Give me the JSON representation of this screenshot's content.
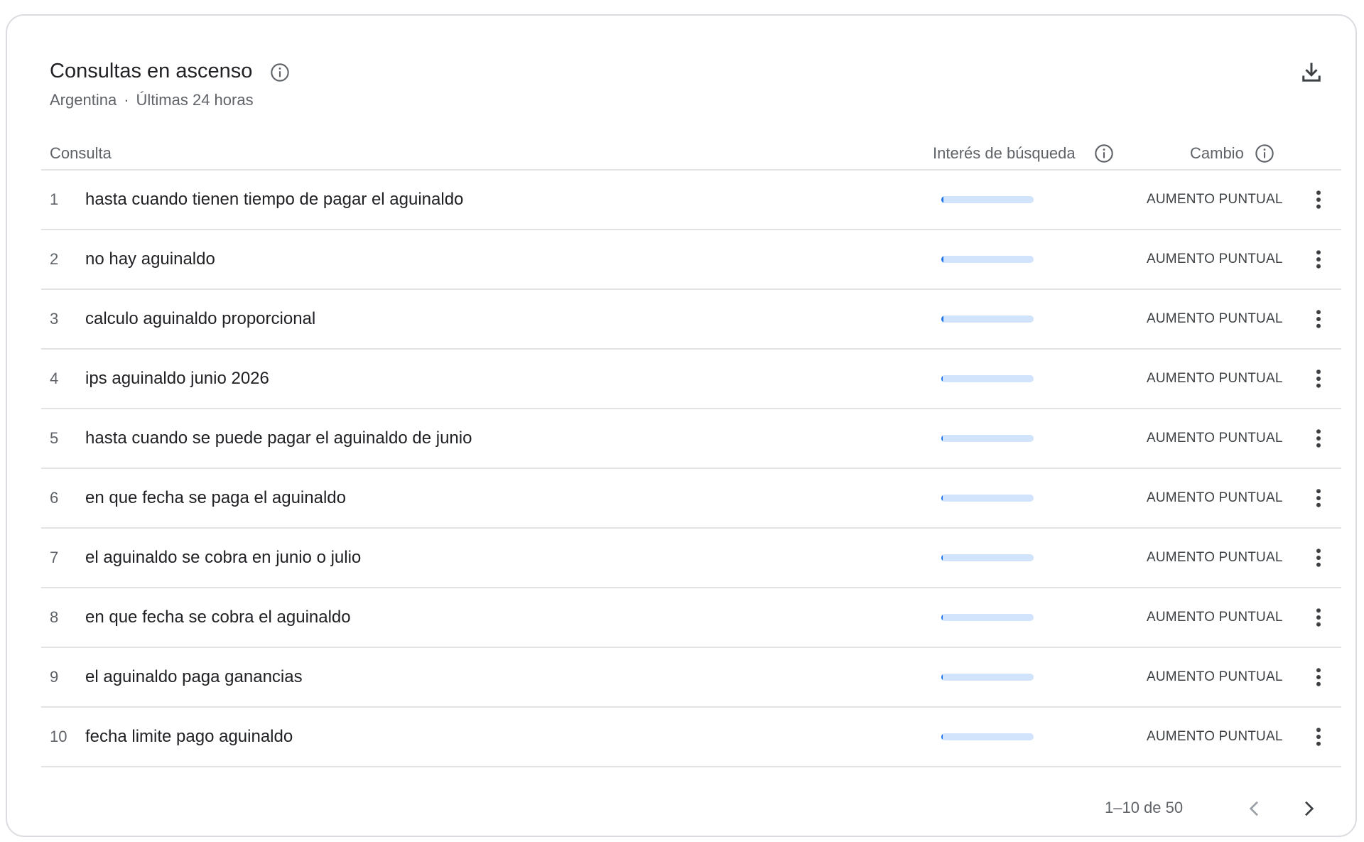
{
  "panel": {
    "title": "Consultas en ascenso",
    "info_icon": "info-circle-icon",
    "region": "Argentina",
    "separator": "·",
    "period": "Últimas 24 horas",
    "download_icon": "download-icon"
  },
  "table": {
    "headers": {
      "query": "Consulta",
      "interest": "Interés de búsqueda",
      "change": "Cambio"
    },
    "rows": [
      {
        "rank": "1",
        "query": "hasta cuando tienen tiempo de pagar el aguinaldo",
        "interest": 0.02,
        "change": "AUMENTO PUNTUAL"
      },
      {
        "rank": "2",
        "query": "no hay aguinaldo",
        "interest": 0.02,
        "change": "AUMENTO PUNTUAL"
      },
      {
        "rank": "3",
        "query": "calculo aguinaldo proporcional",
        "interest": 0.02,
        "change": "AUMENTO PUNTUAL"
      },
      {
        "rank": "4",
        "query": "ips aguinaldo junio 2026",
        "interest": 0.01,
        "change": "AUMENTO PUNTUAL"
      },
      {
        "rank": "5",
        "query": "hasta cuando se puede pagar el aguinaldo de junio",
        "interest": 0.01,
        "change": "AUMENTO PUNTUAL"
      },
      {
        "rank": "6",
        "query": "en que fecha se paga el aguinaldo",
        "interest": 0.01,
        "change": "AUMENTO PUNTUAL"
      },
      {
        "rank": "7",
        "query": "el aguinaldo se cobra en junio o julio",
        "interest": 0.01,
        "change": "AUMENTO PUNTUAL"
      },
      {
        "rank": "8",
        "query": "en que fecha se cobra el aguinaldo",
        "interest": 0.01,
        "change": "AUMENTO PUNTUAL"
      },
      {
        "rank": "9",
        "query": "el aguinaldo paga ganancias",
        "interest": 0.01,
        "change": "AUMENTO PUNTUAL"
      },
      {
        "rank": "10",
        "query": "fecha limite pago aguinaldo",
        "interest": 0.01,
        "change": "AUMENTO PUNTUAL"
      }
    ],
    "row_menu_icon": "more-vert-icon"
  },
  "pagination": {
    "label": "1–10 de 50",
    "prev_icon": "chevron-left-icon",
    "next_icon": "chevron-right-icon"
  },
  "colors": {
    "bar_track": "#d2e3fc",
    "bar_fill": "#1a73e8",
    "text_primary": "#202124",
    "text_secondary": "#5f6368",
    "divider": "#e3e3e3"
  }
}
